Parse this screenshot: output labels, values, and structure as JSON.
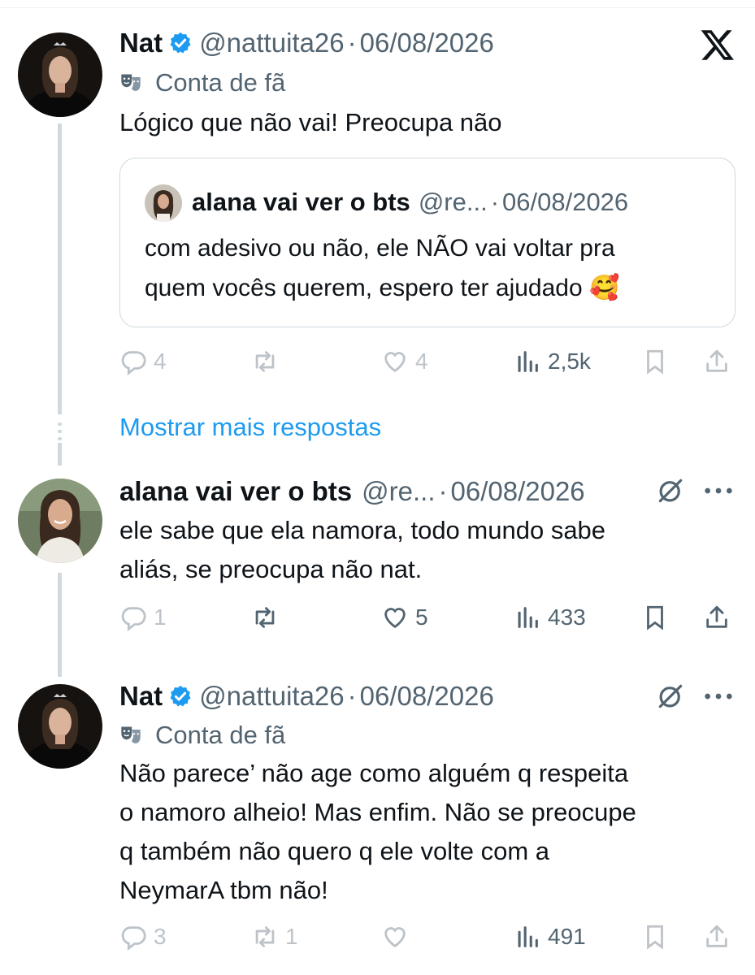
{
  "tweet1": {
    "name": "Nat",
    "handle": "@nattuita26",
    "sep": "·",
    "date": "06/08/2026",
    "badge": "Conta de fã",
    "text": "Lógico que não vai! Preocupa não",
    "quote": {
      "name": "alana vai ver o bts",
      "handle": "@re...",
      "sep": "·",
      "date": "06/08/2026",
      "lines": [
        "com adesivo ou não, ele NÃO vai voltar pra",
        "quem vocês querem, espero ter ajudado 🥰"
      ]
    },
    "replies": "4",
    "likes": "4",
    "views": "2,5k"
  },
  "show_more": "Mostrar mais respostas",
  "tweet2": {
    "name": "alana vai ver o bts",
    "handle": "@re...",
    "sep": "·",
    "date": "06/08/2026",
    "lines": [
      "ele sabe que ela namora, todo mundo sabe",
      "aliás, se preocupa não nat."
    ],
    "replies": "1",
    "likes": "5",
    "views": "433"
  },
  "tweet3": {
    "name": "Nat",
    "handle": "@nattuita26",
    "sep": "·",
    "date": "06/08/2026",
    "badge": "Conta de fã",
    "lines": [
      "Não parece’ não age como alguém q respeita",
      "o namoro alheio! Mas enfim. Não se preocupe",
      "q também não quero q ele volte com a",
      "NeymarA tbm não!"
    ],
    "replies": "3",
    "retweets": "1",
    "views": "491"
  },
  "colors": {
    "accent": "#1d9bf0",
    "secondary_text": "#536471",
    "border": "#cfd9de"
  },
  "icons": [
    "verified-badge-icon",
    "theater-masks-icon",
    "x-logo-icon",
    "reply-icon",
    "retweet-icon",
    "like-icon",
    "views-icon",
    "bookmark-icon",
    "share-icon",
    "grok-icon",
    "more-icon"
  ]
}
